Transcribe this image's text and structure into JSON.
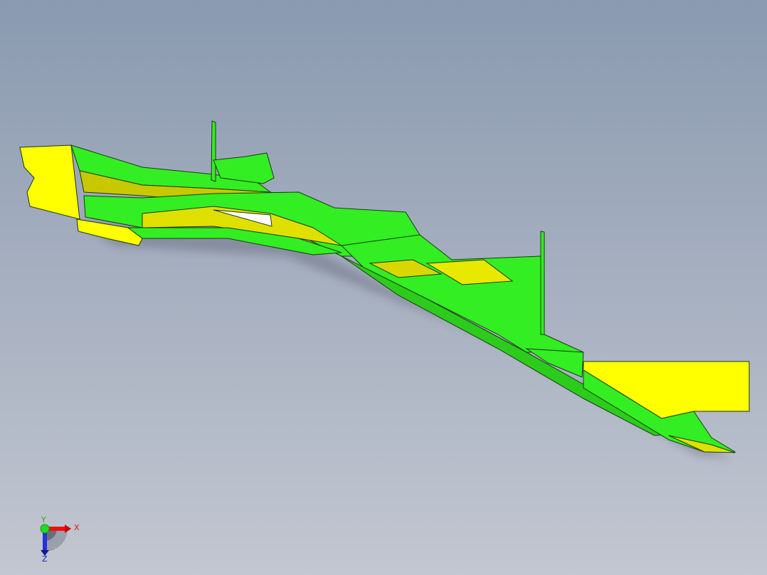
{
  "viewport": {
    "model": {
      "primary_color": "#33ee22",
      "secondary_color": "#ffff00",
      "edge_color": "#1a3a10"
    },
    "triad": {
      "x_label": "X",
      "y_label": "Y",
      "z_label": "Z",
      "x_color": "#ee1111",
      "y_color": "#22cc22",
      "z_color": "#1122cc"
    }
  }
}
